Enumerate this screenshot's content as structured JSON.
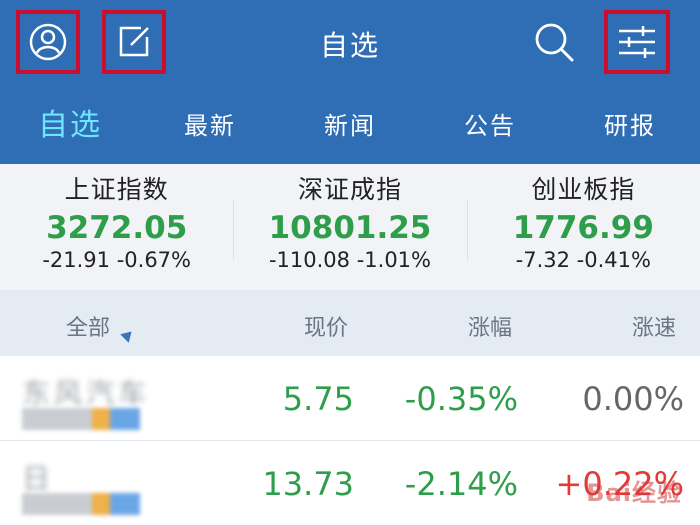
{
  "header": {
    "title": "自选",
    "icons": [
      "profile-icon",
      "edit-icon",
      "search-icon",
      "settings-sliders-icon"
    ]
  },
  "tabs": [
    {
      "label": "自选",
      "active": true
    },
    {
      "label": "最新",
      "active": false
    },
    {
      "label": "新闻",
      "active": false
    },
    {
      "label": "公告",
      "active": false
    },
    {
      "label": "研报",
      "active": false
    }
  ],
  "indices": [
    {
      "name": "上证指数",
      "value": "3272.05",
      "change": "-21.91 -0.67%"
    },
    {
      "name": "深证成指",
      "value": "10801.25",
      "change": "-110.08 -1.01%"
    },
    {
      "name": "创业板指",
      "value": "1776.99",
      "change": "-7.32 -0.41%"
    }
  ],
  "columns": {
    "all": "全部",
    "price": "现价",
    "change_pct": "涨幅",
    "speed": "涨速"
  },
  "rows": [
    {
      "name": "东风汽车",
      "price": "5.75",
      "change_pct": "-0.35%",
      "speed": "0.00%"
    },
    {
      "name": "日",
      "price": "13.73",
      "change_pct": "-2.14%",
      "speed": "+0.22%"
    }
  ],
  "watermark": "Bai经验",
  "colors": {
    "header_bg": "#2f6db5",
    "active_tab": "#6ee4ff",
    "down_green": "#2e9e4b",
    "up_red": "#e53935",
    "highlight_box": "#c8102e"
  }
}
